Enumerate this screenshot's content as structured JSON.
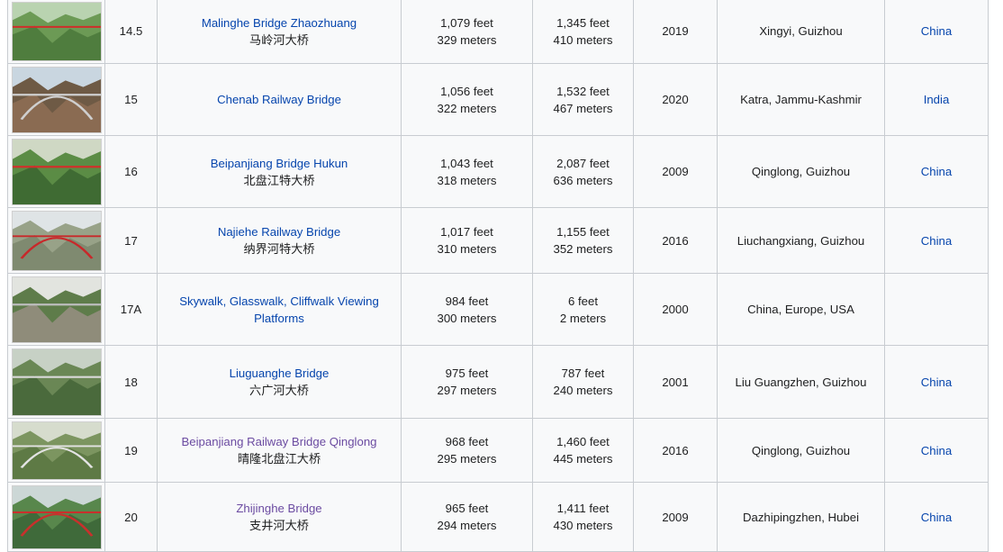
{
  "columns_hint": [
    "image",
    "rank",
    "name",
    "height",
    "span",
    "year",
    "location",
    "country"
  ],
  "rows": [
    {
      "rank": "14.5",
      "name": "Malinghe Bridge Zhaozhuang",
      "name_visited": false,
      "chinese": "马岭河大桥",
      "height_ft": "1,079 feet",
      "height_m": "329 meters",
      "span_ft": "1,345 feet",
      "span_m": "410 meters",
      "year": "2019",
      "location": "Xingyi, Guizhou",
      "country": "China",
      "thumb": {
        "sky": "#b9d3b0",
        "mountain": "#4f7d3e",
        "mountain2": "#6c9a55",
        "bridge": "#cf2e2a",
        "arch": false
      }
    },
    {
      "rank": "15",
      "name": "Chenab Railway Bridge",
      "name_visited": false,
      "chinese": "",
      "height_ft": "1,056 feet",
      "height_m": "322 meters",
      "span_ft": "1,532 feet",
      "span_m": "467 meters",
      "year": "2020",
      "location": "Katra, Jammu-Kashmir",
      "country": "India",
      "thumb": {
        "sky": "#c9d6e0",
        "mountain": "#8a6b52",
        "mountain2": "#6e5a45",
        "bridge": "#cfcfcf",
        "arch": true
      }
    },
    {
      "rank": "16",
      "name": "Beipanjiang Bridge Hukun",
      "name_visited": false,
      "chinese": "北盘江特大桥",
      "height_ft": "1,043 feet",
      "height_m": "318 meters",
      "span_ft": "2,087 feet",
      "span_m": "636 meters",
      "year": "2009",
      "location": "Qinglong, Guizhou",
      "country": "China",
      "thumb": {
        "sky": "#cfd8c4",
        "mountain": "#3f6b33",
        "mountain2": "#5b8c45",
        "bridge": "#d0302b",
        "arch": false
      }
    },
    {
      "rank": "17",
      "name": "Najiehe Railway Bridge",
      "name_visited": false,
      "chinese": "纳界河特大桥",
      "height_ft": "1,017 feet",
      "height_m": "310 meters",
      "span_ft": "1,155 feet",
      "span_m": "352 meters",
      "year": "2016",
      "location": "Liuchangxiang, Guizhou",
      "country": "China",
      "thumb": {
        "sky": "#dfe4e6",
        "mountain": "#7f8a70",
        "mountain2": "#98a288",
        "bridge": "#c8282a",
        "arch": true
      }
    },
    {
      "rank": "17A",
      "name": "Skywalk, Glasswalk, Cliffwalk Viewing Platforms",
      "name_visited": false,
      "chinese": "",
      "height_ft": "984 feet",
      "height_m": "300 meters",
      "span_ft": "6 feet",
      "span_m": "2 meters",
      "year": "2000",
      "location": "China, Europe, USA",
      "country": "",
      "thumb": {
        "sky": "#e2e4df",
        "mountain": "#8f8c7a",
        "mountain2": "#5e7c4a",
        "bridge": "#bdbdbd",
        "arch": false
      }
    },
    {
      "rank": "18",
      "name": "Liuguanghe Bridge",
      "name_visited": false,
      "chinese": "六广河大桥",
      "height_ft": "975 feet",
      "height_m": "297 meters",
      "span_ft": "787 feet",
      "span_m": "240 meters",
      "year": "2001",
      "location": "Liu Guangzhen, Guizhou",
      "country": "China",
      "thumb": {
        "sky": "#c7d1c5",
        "mountain": "#4a6a3c",
        "mountain2": "#6a8755",
        "bridge": "#d9d9d9",
        "arch": false
      }
    },
    {
      "rank": "19",
      "name": "Beipanjiang Railway Bridge Qinglong",
      "name_visited": true,
      "chinese": "晴隆北盘江大桥",
      "height_ft": "968 feet",
      "height_m": "295 meters",
      "span_ft": "1,460 feet",
      "span_m": "445 meters",
      "year": "2016",
      "location": "Qinglong, Guizhou",
      "country": "China",
      "thumb": {
        "sky": "#d6dccd",
        "mountain": "#5e7a45",
        "mountain2": "#7c9560",
        "bridge": "#e3e3e3",
        "arch": true
      }
    },
    {
      "rank": "20",
      "name": "Zhijinghe Bridge",
      "name_visited": true,
      "chinese": "支井河大桥",
      "height_ft": "965 feet",
      "height_m": "294 meters",
      "span_ft": "1,411 feet",
      "span_m": "430 meters",
      "year": "2009",
      "location": "Dazhipingzhen, Hubei",
      "country": "China",
      "thumb": {
        "sky": "#ccd7d6",
        "mountain": "#3f6a3a",
        "mountain2": "#58874c",
        "bridge": "#c9302c",
        "arch": true
      }
    }
  ]
}
